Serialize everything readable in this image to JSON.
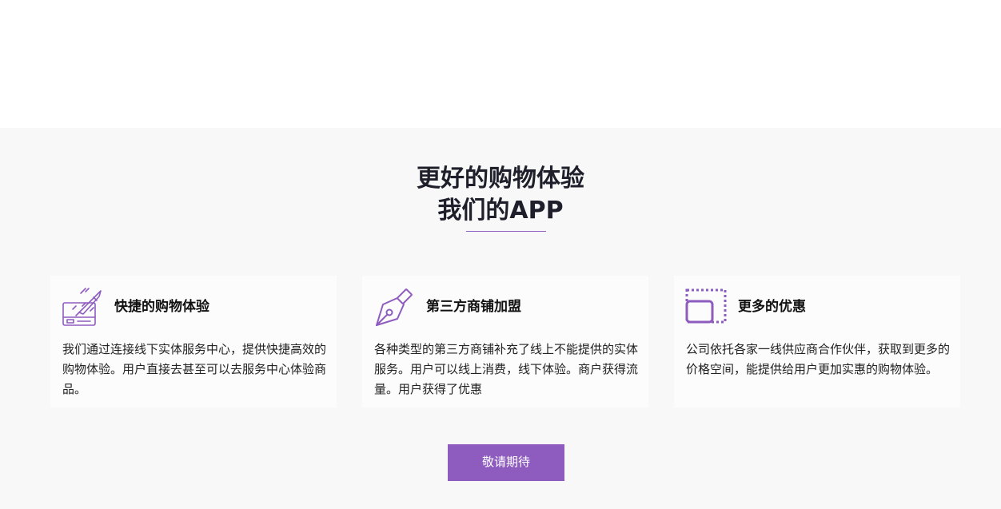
{
  "heading": {
    "line1": "更好的购物体验",
    "line2": "我们的APP"
  },
  "accent_color": "#8e5cbf",
  "features": [
    {
      "icon": "rocket-card-icon",
      "title": "快捷的购物体验",
      "text": "我们通过连接线下实体服务中心，提供快捷高效的购物体验。用户直接去甚至可以去服务中心体验商品。"
    },
    {
      "icon": "pen-nib-icon",
      "title": "第三方商铺加盟",
      "text": "各种类型的第三方商铺补充了线上不能提供的实体服务。用户可以线上消费，线下体验。商户获得流量。用户获得了优惠"
    },
    {
      "icon": "dotted-frame-icon",
      "title": "更多的优惠",
      "text": "公司依托各家一线供应商合作伙伴，获取到更多的价格空间，能提供给用户更加实惠的购物体验。"
    }
  ],
  "cta": {
    "label": "敬请期待"
  }
}
